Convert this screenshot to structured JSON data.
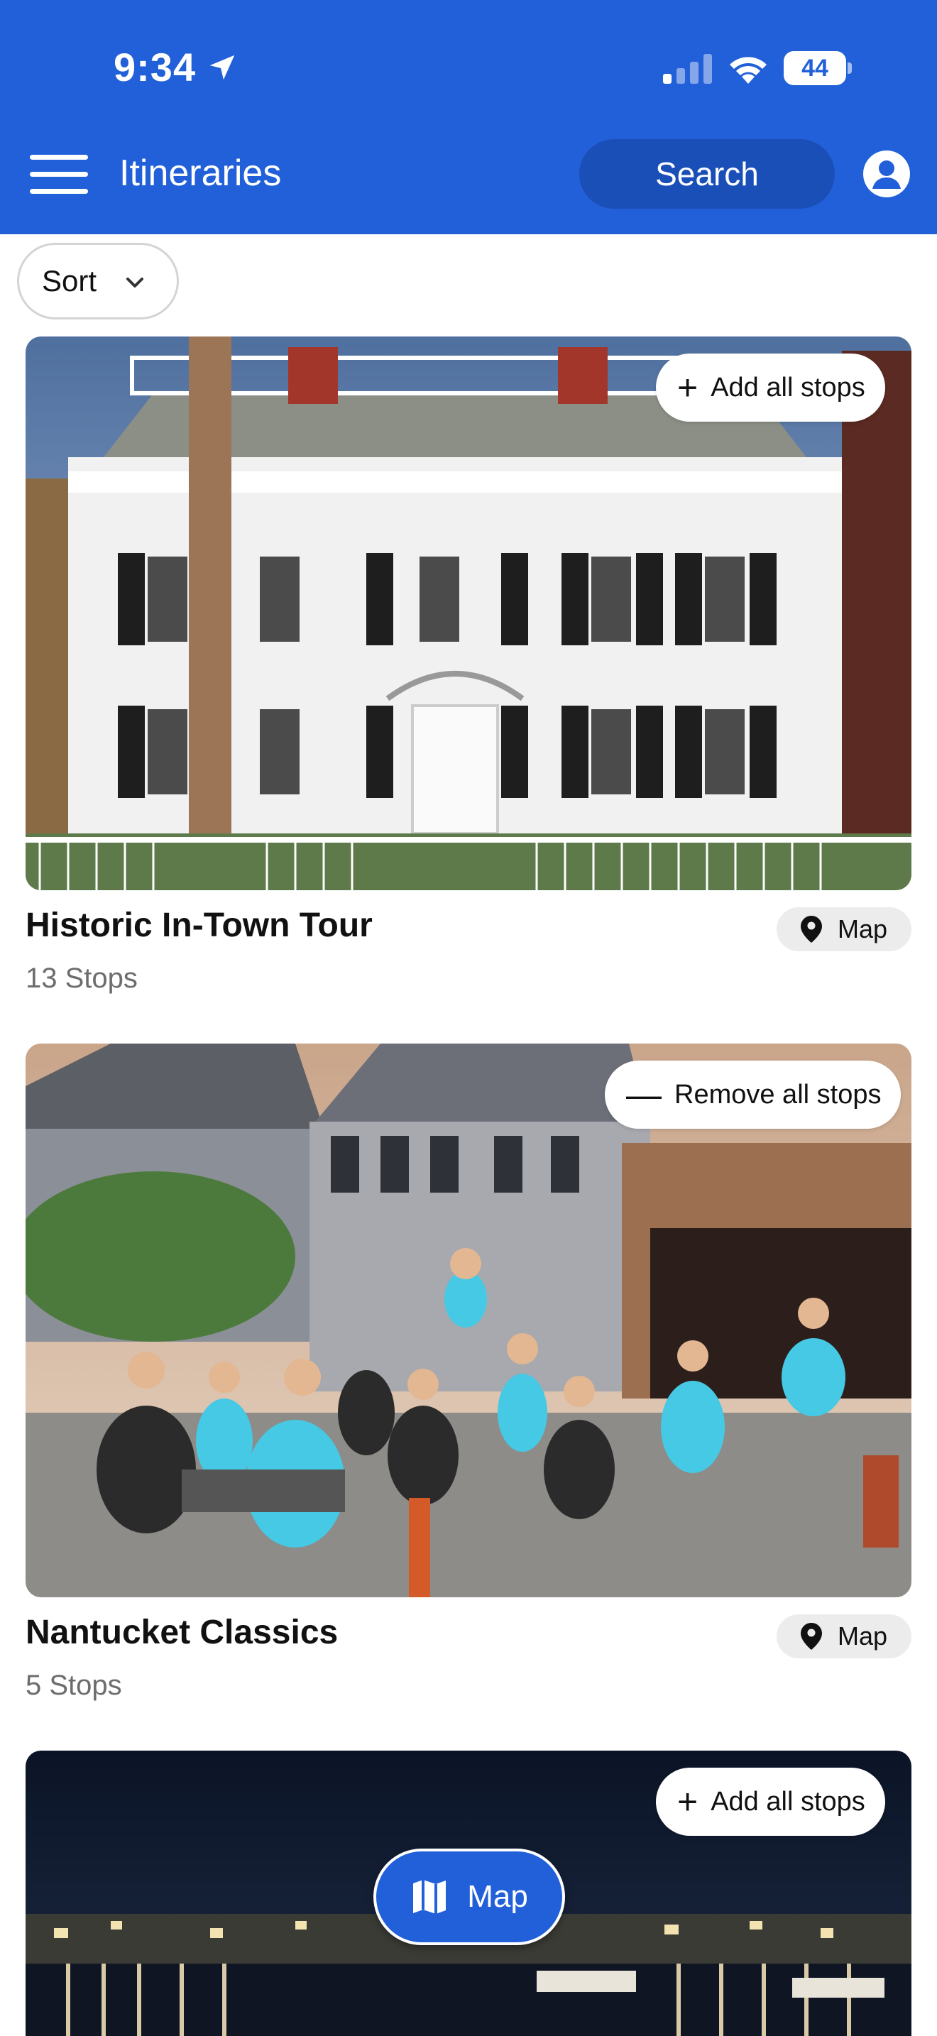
{
  "status_bar": {
    "time": "9:34",
    "battery": "44"
  },
  "header": {
    "title": "Itineraries",
    "search_label": "Search",
    "menu_icon": "hamburger-menu-icon",
    "profile_icon": "user-profile-icon"
  },
  "sort": {
    "label": "Sort"
  },
  "itineraries": [
    {
      "title": "Historic In-Town Tour",
      "stops": "13 Stops",
      "action_label": "Add all stops",
      "map_label": "Map"
    },
    {
      "title": "Nantucket Classics",
      "stops": "5 Stops",
      "action_label": "Remove all stops",
      "map_label": "Map"
    },
    {
      "action_label": "Add all stops"
    }
  ],
  "floating_button": {
    "label": "Map"
  },
  "colors": {
    "brand_blue": "#2160d8",
    "search_pill": "#1a4fb8",
    "chip_bg": "#ececec",
    "subtext": "#6d6d6d"
  }
}
